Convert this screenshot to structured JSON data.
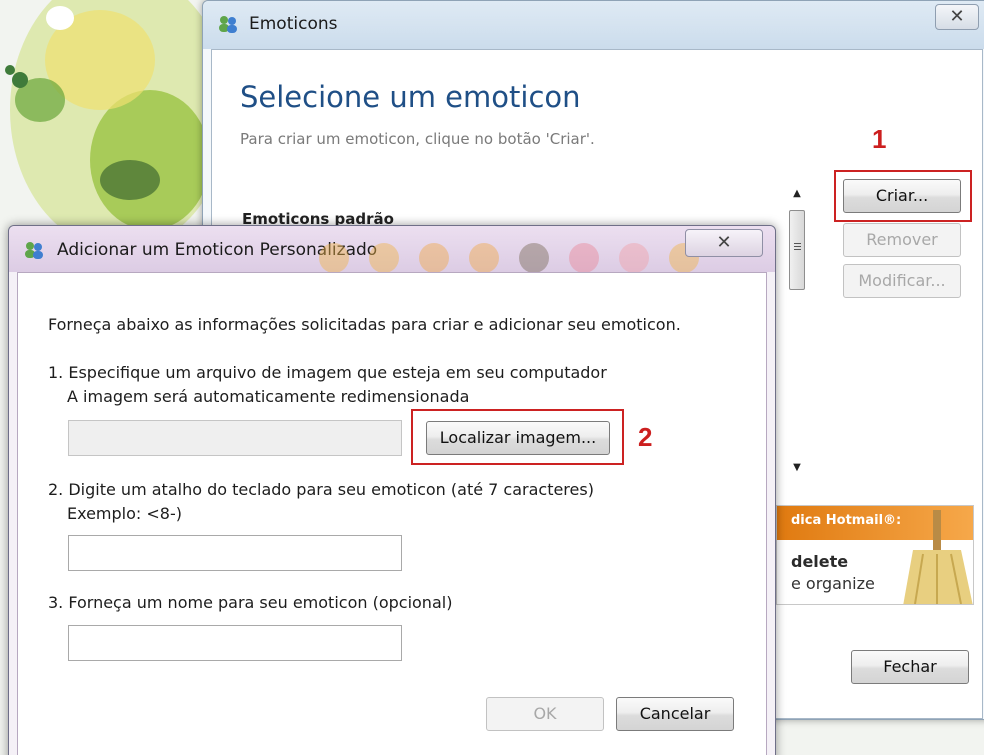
{
  "back_window": {
    "title": "Emoticons",
    "close_glyph": "✕",
    "heading": "Selecione um emoticon",
    "subheading": "Para criar um emoticon, clique no botão 'Criar'.",
    "section_label": "Emoticons padrão",
    "buttons": {
      "criar": "Criar...",
      "remover": "Remover",
      "modificar": "Modificar...",
      "fechar": "Fechar"
    },
    "ad": {
      "tag": "dica Hotmail®:",
      "line1": "delete",
      "line2": "e organize"
    }
  },
  "annotations": {
    "step1": "1",
    "step2": "2"
  },
  "front_dialog": {
    "title": "Adicionar um Emoticon Personalizado",
    "close_glyph": "✕",
    "intro": "Forneça abaixo as informações solicitadas para criar e adicionar seu emoticon.",
    "step1_line1": "1. Especifique um arquivo de imagem que esteja em seu computador",
    "step1_line2": "A imagem será automaticamente redimensionada",
    "image_path_value": "",
    "locate_button": "Localizar imagem...",
    "step2_line1": "2. Digite um atalho do teclado para seu emoticon (até 7 caracteres)",
    "step2_line2": "Exemplo: <8-)",
    "shortcut_value": "",
    "step3_line1": "3. Forneça um nome para seu emoticon (opcional)",
    "name_value": "",
    "ok_button": "OK",
    "cancel_button": "Cancelar"
  },
  "colors": {
    "heading_blue": "#1f4f86",
    "annotation_red": "#cc1f1f",
    "ad_orange": "#e88a20"
  },
  "icons": {
    "window_icon": "messenger-buddies-icon",
    "close": "close-icon",
    "scroll_up": "scroll-up-icon",
    "scroll_down": "scroll-down-icon"
  }
}
